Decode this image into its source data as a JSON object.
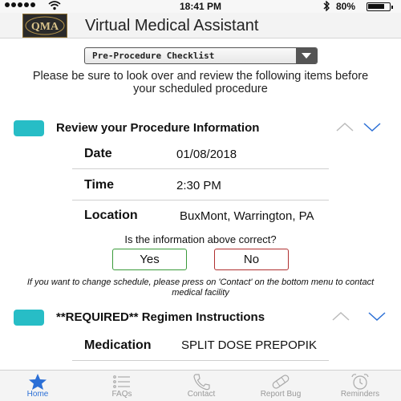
{
  "status_bar": {
    "time": "18:41 PM",
    "battery_percent_text": "80%",
    "battery_level": 0.8
  },
  "header": {
    "logo_text": "QMA",
    "title": "Virtual Medical Assistant"
  },
  "dropdown": {
    "selected": "Pre-Procedure Checklist"
  },
  "intro_text": "Please be sure to look over and review the following items before your scheduled procedure",
  "procedure_section": {
    "title": "Review your Procedure Information",
    "rows": [
      {
        "label": "Date",
        "value": "01/08/2018"
      },
      {
        "label": "Time",
        "value": "2:30 PM"
      },
      {
        "label": "Location",
        "value": "BuxMont, Warrington, PA"
      }
    ],
    "question": "Is the information above correct?",
    "yes_label": "Yes",
    "no_label": "No",
    "note": "If you want to change schedule, please press on 'Contact' on the bottom menu to contact medical facility"
  },
  "regimen_section": {
    "title": "**REQUIRED** Regimen Instructions",
    "rows": [
      {
        "label": "Medication",
        "value": "SPLIT DOSE PREPOPIK"
      }
    ]
  },
  "tabs": [
    {
      "label": "Home",
      "icon": "star-icon",
      "active": true
    },
    {
      "label": "FAQs",
      "icon": "list-icon",
      "active": false
    },
    {
      "label": "Contact",
      "icon": "phone-icon",
      "active": false
    },
    {
      "label": "Report Bug",
      "icon": "bandage-icon",
      "active": false
    },
    {
      "label": "Reminders",
      "icon": "alarm-clock-icon",
      "active": false
    }
  ],
  "colors": {
    "accent_teal": "#27bdc6",
    "active_tab_blue": "#2b6fd6",
    "yes_border": "#3a9b3a",
    "no_border": "#b03030"
  }
}
